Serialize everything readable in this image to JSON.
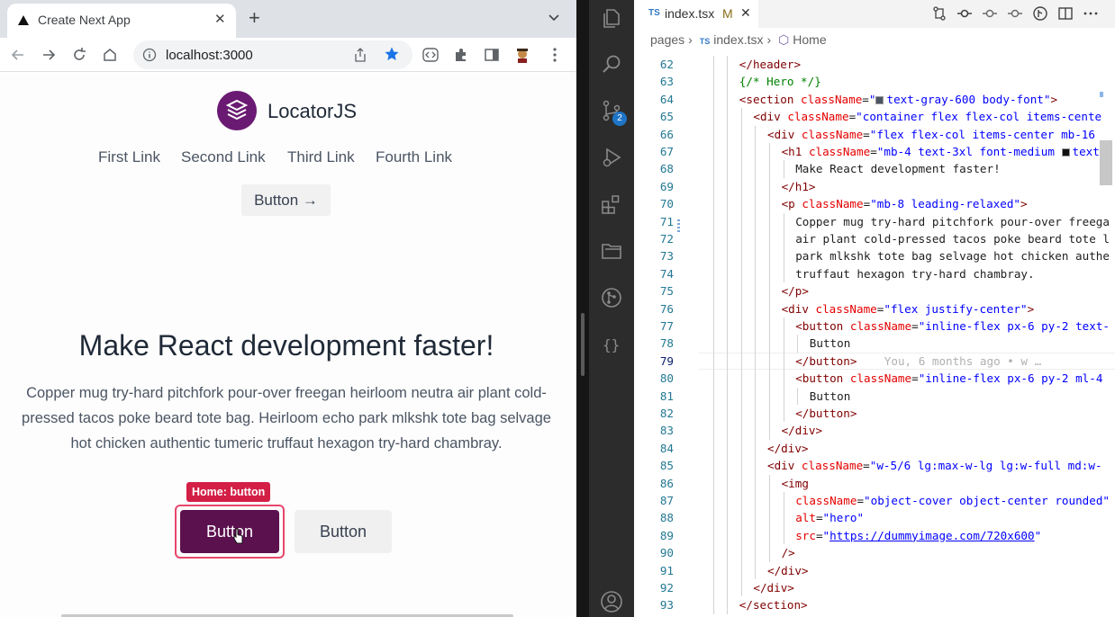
{
  "browser": {
    "tab_title": "Create Next App",
    "url": "localhost:3000"
  },
  "site": {
    "logo_text": "LocatorJS",
    "nav": [
      "First Link",
      "Second Link",
      "Third Link",
      "Fourth Link"
    ],
    "top_button": "Button →",
    "hero_title": "Make React development faster!",
    "hero_text": "Copper mug try-hard pitchfork pour-over freegan heirloom neutra air plant cold-pressed tacos poke beard tote bag. Heirloom echo park mlkshk tote bag selvage hot chicken authentic tumeric truffaut hexagon try-hard chambray.",
    "locator_tag": "Home: button",
    "primary_button": "Button",
    "secondary_button": "Button",
    "primary_color": "#5c114f",
    "tag_color": "#d31f45"
  },
  "vscode": {
    "tab_file": "index.tsx",
    "tab_badge": "TS",
    "tab_modified": "M",
    "scm_badge": "2",
    "breadcrumb": {
      "folder": "pages",
      "file": "index.tsx",
      "symbol": "Home"
    },
    "current_line": "79",
    "blame": "You, 6 months ago • w …",
    "lines": [
      {
        "n": "62",
        "indent": 3,
        "tokens": [
          [
            "t-tag",
            "</header>"
          ]
        ]
      },
      {
        "n": "63",
        "indent": 3,
        "tokens": [
          [
            "t-cmt",
            "{/* Hero */}"
          ]
        ]
      },
      {
        "n": "64",
        "indent": 3,
        "tokens": [
          [
            "t-tag",
            "<section "
          ],
          [
            "t-attr",
            "className"
          ],
          [
            "",
            "="
          ],
          [
            "t-str",
            "\""
          ],
          [
            "swatch:#4b5563",
            ""
          ],
          [
            "t-str",
            "text-gray-600 body-font\""
          ],
          [
            "t-tag",
            ">"
          ]
        ]
      },
      {
        "n": "65",
        "indent": 4,
        "tokens": [
          [
            "t-tag",
            "<div "
          ],
          [
            "t-attr",
            "className"
          ],
          [
            "",
            "="
          ],
          [
            "t-str",
            "\"container flex flex-col items-cente"
          ]
        ]
      },
      {
        "n": "66",
        "indent": 5,
        "tokens": [
          [
            "t-tag",
            "<div "
          ],
          [
            "t-attr",
            "className"
          ],
          [
            "",
            "="
          ],
          [
            "t-str",
            "\"flex flex-col items-center mb-16 "
          ]
        ]
      },
      {
        "n": "67",
        "indent": 6,
        "tokens": [
          [
            "t-tag",
            "<h1 "
          ],
          [
            "t-attr",
            "className"
          ],
          [
            "",
            "="
          ],
          [
            "t-str",
            "\"mb-4 text-3xl font-medium "
          ],
          [
            "swatch:#111111",
            ""
          ],
          [
            "t-str",
            "text-"
          ]
        ]
      },
      {
        "n": "68",
        "indent": 7,
        "tokens": [
          [
            "",
            "Make React development faster!"
          ]
        ]
      },
      {
        "n": "69",
        "indent": 6,
        "tokens": [
          [
            "t-tag",
            "</h1>"
          ]
        ]
      },
      {
        "n": "70",
        "indent": 6,
        "tokens": [
          [
            "t-tag",
            "<p "
          ],
          [
            "t-attr",
            "className"
          ],
          [
            "",
            "="
          ],
          [
            "t-str",
            "\"mb-8 leading-relaxed\""
          ],
          [
            "t-tag",
            ">"
          ]
        ]
      },
      {
        "n": "71",
        "indent": 7,
        "tokens": [
          [
            "",
            "Copper mug try-hard pitchfork pour-over freega"
          ]
        ]
      },
      {
        "n": "72",
        "indent": 7,
        "tokens": [
          [
            "",
            "air plant cold-pressed tacos poke beard tote l"
          ]
        ]
      },
      {
        "n": "73",
        "indent": 7,
        "tokens": [
          [
            "",
            "park mlkshk tote bag selvage hot chicken authe"
          ]
        ]
      },
      {
        "n": "74",
        "indent": 7,
        "tokens": [
          [
            "",
            "truffaut hexagon try-hard chambray."
          ]
        ]
      },
      {
        "n": "75",
        "indent": 6,
        "tokens": [
          [
            "t-tag",
            "</p>"
          ]
        ]
      },
      {
        "n": "76",
        "indent": 6,
        "tokens": [
          [
            "t-tag",
            "<div "
          ],
          [
            "t-attr",
            "className"
          ],
          [
            "",
            "="
          ],
          [
            "t-str",
            "\"flex justify-center\""
          ],
          [
            "t-tag",
            ">"
          ]
        ]
      },
      {
        "n": "77",
        "indent": 7,
        "tokens": [
          [
            "t-tag",
            "<button "
          ],
          [
            "t-attr",
            "className"
          ],
          [
            "",
            "="
          ],
          [
            "t-str",
            "\"inline-flex px-6 py-2 text-"
          ]
        ]
      },
      {
        "n": "78",
        "indent": 8,
        "tokens": [
          [
            "",
            "Button"
          ]
        ]
      },
      {
        "n": "79",
        "indent": 7,
        "tokens": [
          [
            "t-tag",
            "</button>"
          ],
          [
            "",
            "    "
          ],
          [
            "blame",
            "You, 6 months ago • w …"
          ]
        ]
      },
      {
        "n": "80",
        "indent": 7,
        "tokens": [
          [
            "t-tag",
            "<button "
          ],
          [
            "t-attr",
            "className"
          ],
          [
            "",
            "="
          ],
          [
            "t-str",
            "\"inline-flex px-6 py-2 ml-4"
          ]
        ]
      },
      {
        "n": "81",
        "indent": 8,
        "tokens": [
          [
            "",
            "Button"
          ]
        ]
      },
      {
        "n": "82",
        "indent": 7,
        "tokens": [
          [
            "t-tag",
            "</button>"
          ]
        ]
      },
      {
        "n": "83",
        "indent": 6,
        "tokens": [
          [
            "t-tag",
            "</div>"
          ]
        ]
      },
      {
        "n": "84",
        "indent": 5,
        "tokens": [
          [
            "t-tag",
            "</div>"
          ]
        ]
      },
      {
        "n": "85",
        "indent": 5,
        "tokens": [
          [
            "t-tag",
            "<div "
          ],
          [
            "t-attr",
            "className"
          ],
          [
            "",
            "="
          ],
          [
            "t-str",
            "\"w-5/6 lg:max-w-lg lg:w-full md:w-"
          ]
        ]
      },
      {
        "n": "86",
        "indent": 6,
        "tokens": [
          [
            "t-tag",
            "<img"
          ]
        ]
      },
      {
        "n": "87",
        "indent": 7,
        "tokens": [
          [
            "t-attr",
            "className"
          ],
          [
            "",
            "="
          ],
          [
            "t-str",
            "\"object-cover object-center rounded\""
          ]
        ]
      },
      {
        "n": "88",
        "indent": 7,
        "tokens": [
          [
            "t-attr",
            "alt"
          ],
          [
            "",
            "="
          ],
          [
            "t-str",
            "\"hero\""
          ]
        ]
      },
      {
        "n": "89",
        "indent": 7,
        "tokens": [
          [
            "t-attr",
            "src"
          ],
          [
            "",
            "="
          ],
          [
            "t-str",
            "\""
          ],
          [
            "t-url",
            "https://dummyimage.com/720x600"
          ],
          [
            "t-str",
            "\""
          ]
        ]
      },
      {
        "n": "90",
        "indent": 6,
        "tokens": [
          [
            "t-tag",
            "/>"
          ]
        ]
      },
      {
        "n": "91",
        "indent": 5,
        "tokens": [
          [
            "t-tag",
            "</div>"
          ]
        ]
      },
      {
        "n": "92",
        "indent": 4,
        "tokens": [
          [
            "t-tag",
            "</div>"
          ]
        ]
      },
      {
        "n": "93",
        "indent": 3,
        "tokens": [
          [
            "t-tag",
            "</section>"
          ]
        ]
      }
    ]
  }
}
